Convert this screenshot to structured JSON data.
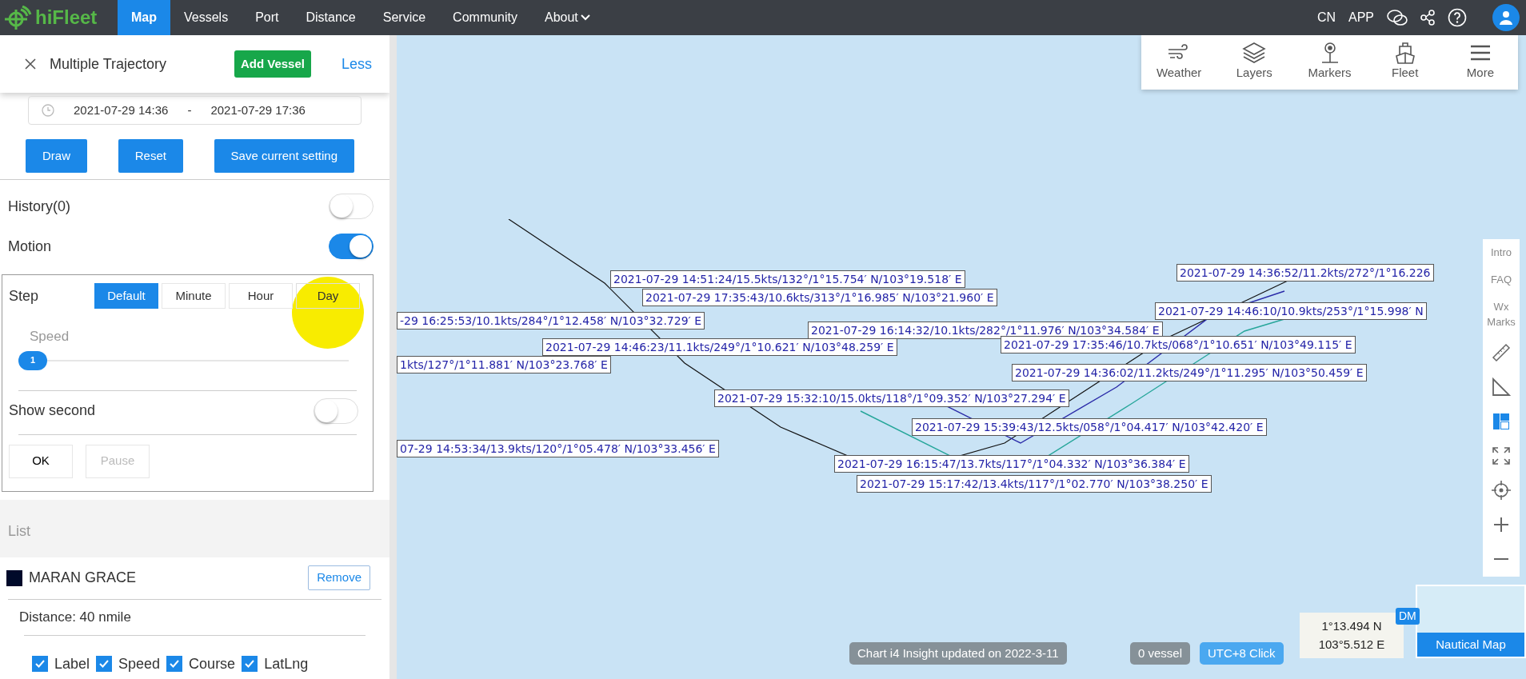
{
  "nav": {
    "logo": "hiFleet",
    "items": [
      {
        "label": "Map",
        "selected": true,
        "dropdown": false
      },
      {
        "label": "Vessels",
        "selected": false,
        "dropdown": false
      },
      {
        "label": "Port",
        "selected": false,
        "dropdown": false
      },
      {
        "label": "Distance",
        "selected": false,
        "dropdown": false
      },
      {
        "label": "Service",
        "selected": false,
        "dropdown": false
      },
      {
        "label": "Community",
        "selected": false,
        "dropdown": false
      },
      {
        "label": "About",
        "selected": false,
        "dropdown": true
      }
    ],
    "right_links": [
      "CN",
      "APP"
    ]
  },
  "panel": {
    "title": "Multiple Trajectory",
    "add_button": "Add Vessel",
    "less_link": "Less",
    "date_from": "2021-07-29 14:36",
    "date_separator": "-",
    "date_to": "2021-07-29 17:36",
    "actions": [
      "Draw",
      "Reset",
      "Save current setting"
    ],
    "toggles": [
      {
        "label": "History(0)",
        "on": false
      },
      {
        "label": "Motion",
        "on": true
      }
    ],
    "step": {
      "label": "Step",
      "options": [
        {
          "label": "Default",
          "selected": true
        },
        {
          "label": "Minute",
          "selected": false
        },
        {
          "label": "Hour",
          "selected": false
        },
        {
          "label": "Day",
          "selected": false
        }
      ]
    },
    "speed": {
      "label": "Speed",
      "level": 0,
      "reading": "1"
    },
    "show_second": {
      "label": "Show second",
      "on": false
    },
    "ok_button": "OK",
    "pause_button": {
      "label": "Pause",
      "disabled": true
    },
    "list_title": "List",
    "vessels": [
      {
        "name": "MARAN GRACE",
        "color": "#000a2a",
        "remove": "Remove",
        "distance": "Distance: 40 nmile",
        "options": [
          {
            "label": "Label",
            "checked": true
          },
          {
            "label": "Speed",
            "checked": true
          },
          {
            "label": "Course",
            "checked": true
          },
          {
            "label": "LatLng",
            "checked": true
          }
        ]
      }
    ]
  },
  "map": {
    "toolbar": [
      "Weather",
      "Layers",
      "Markers",
      "Fleet",
      "More"
    ],
    "side_links": [
      "Intro",
      "FAQ",
      "Wx Marks"
    ],
    "track_labels": [
      "2021-07-29 14:36:52/11.2kts/272°/1°16.226",
      "2021-07-29 14:51:24/15.5kts/132°/1°15.754′ N/103°19.518′ E",
      "2021-07-29 17:35:43/10.6kts/313°/1°16.985′ N/103°21.960′ E",
      "2021-07-29 14:46:10/10.9kts/253°/1°15.998′ N",
      "-29 16:25:53/10.1kts/284°/1°12.458′ N/103°32.729′ E",
      "2021-07-29 16:14:32/10.1kts/282°/1°11.976′ N/103°34.584′ E",
      "2021-07-29 14:46:23/11.1kts/249°/1°10.621′ N/103°48.259′ E",
      "2021-07-29 17:35:46/10.7kts/068°/1°10.651′ N/103°49.115′ E",
      "1kts/127°/1°11.881′ N/103°23.768′ E",
      "2021-07-29 14:36:02/11.2kts/249°/1°11.295′ N/103°50.459′ E",
      "2021-07-29 15:32:10/15.0kts/118°/1°09.352′ N/103°27.294′ E",
      "2021-07-29 15:39:43/12.5kts/058°/1°04.417′ N/103°42.420′ E",
      "07-29 14:53:34/13.9kts/120°/1°05.478′ N/103°33.456′ E",
      "2021-07-29 16:15:47/13.7kts/117°/1°04.332′ N/103°36.384′ E",
      "2021-07-29 15:17:42/13.4kts/117°/1°02.770′ N/103°38.250′ E"
    ],
    "status": {
      "chart_info": "Chart i4 Insight updated on 2022-3-11",
      "vessel_count": "0 vessel",
      "timezone": "UTC+8 Click",
      "lat": "1°13.494 N",
      "lng": "103°5.512 E",
      "dm": "DM",
      "minimap_label": "Nautical Map"
    }
  }
}
